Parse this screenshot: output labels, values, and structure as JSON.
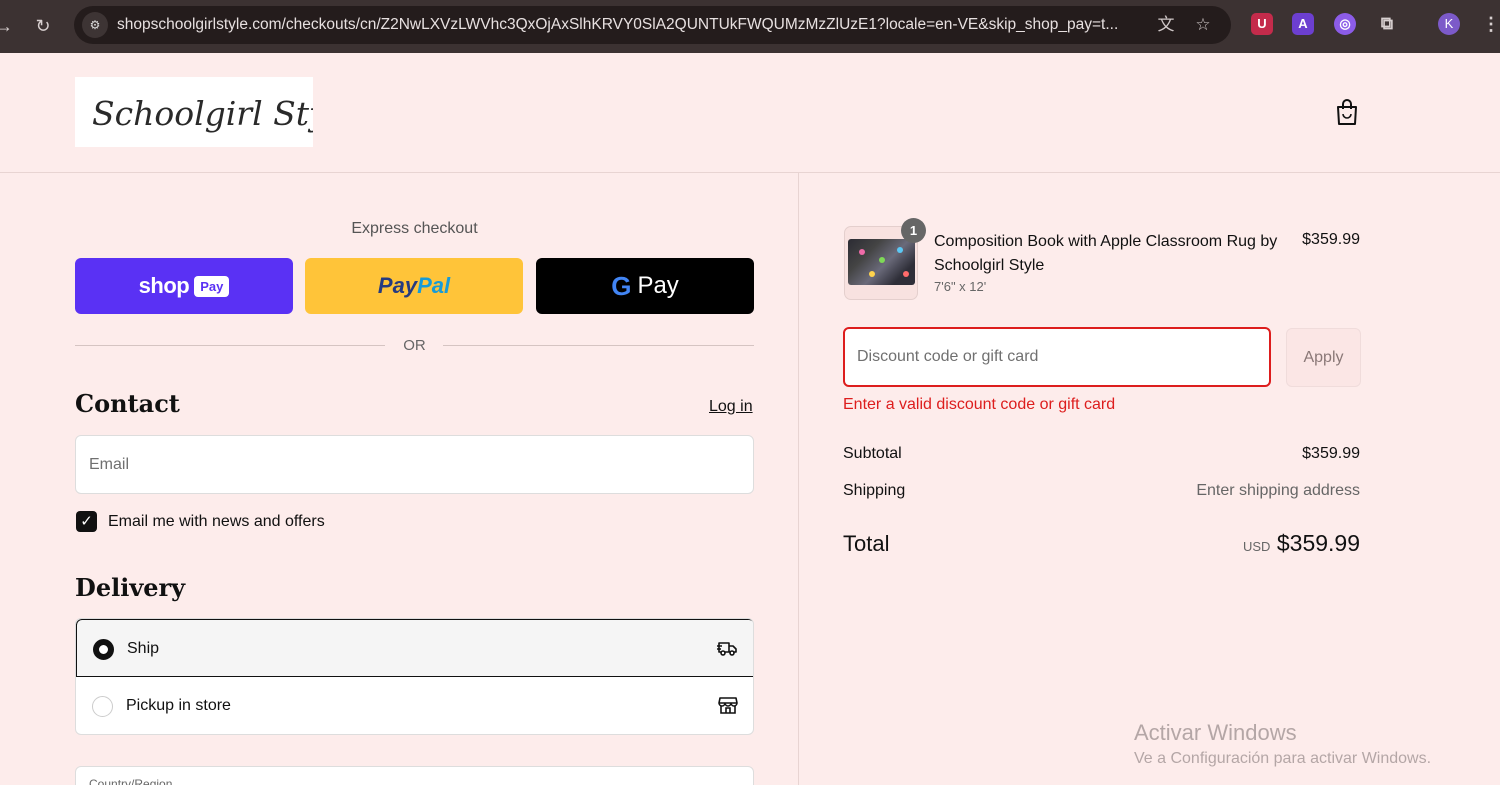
{
  "browser": {
    "url": "shopschoolgirlstyle.com/checkouts/cn/Z2NwLXVzLWVhc3QxOjAxSlhKRVY0SlA2QUNTUkFWQUMzMzZlUzE1?locale=en-VE&skip_shop_pay=t...",
    "profile_initial": "K",
    "icons": [
      "back-icon",
      "reload-icon",
      "site-settings-icon",
      "translate-icon",
      "bookmark-star-icon",
      "ublock-extension-icon",
      "a-extension-icon",
      "purple-extension-icon",
      "extensions-puzzle-icon",
      "menu-kebab-icon"
    ]
  },
  "header": {
    "logo_text": "Schoolgirl Style",
    "cart_icon": "shopping-bag-icon"
  },
  "express": {
    "label": "Express checkout",
    "shoppay_word": "shop",
    "shoppay_pill": "Pay",
    "paypal_part1": "Pay",
    "paypal_part2": "Pal",
    "gpay_g": "G",
    "gpay_word": "Pay",
    "or": "OR"
  },
  "contact": {
    "title": "Contact",
    "login": "Log in",
    "email_placeholder": "Email",
    "newsletter_label": "Email me with news and offers",
    "newsletter_checked": true
  },
  "delivery": {
    "title": "Delivery",
    "options": [
      {
        "label": "Ship",
        "selected": true,
        "icon": "truck-icon"
      },
      {
        "label": "Pickup in store",
        "selected": false,
        "icon": "store-icon"
      }
    ],
    "country_label": "Country/Region"
  },
  "order": {
    "item": {
      "name": "Composition Book with Apple Classroom Rug by Schoolgirl Style",
      "variant": "7'6\" x 12'",
      "price": "$359.99",
      "quantity": "1"
    },
    "discount": {
      "placeholder": "Discount code or gift card",
      "apply": "Apply",
      "error": "Enter a valid discount code or gift card"
    },
    "subtotal_label": "Subtotal",
    "subtotal_value": "$359.99",
    "shipping_label": "Shipping",
    "shipping_value": "Enter shipping address",
    "total_label": "Total",
    "total_currency": "USD",
    "total_value": "$359.99"
  },
  "watermark": {
    "line1": "Activar Windows",
    "line2": "Ve a Configuración para activar Windows."
  },
  "colors": {
    "page_bg": "#fdeceb",
    "shoppay": "#5a31f4",
    "paypal": "#ffc439",
    "gpay": "#000000",
    "error": "#dd1d1d"
  }
}
